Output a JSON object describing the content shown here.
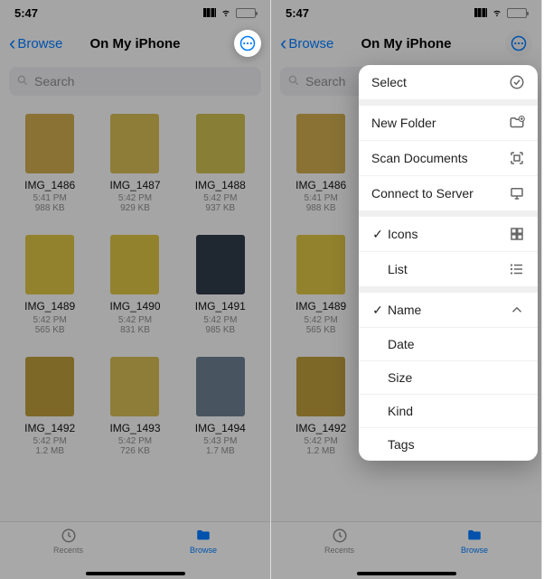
{
  "status": {
    "time": "5:47"
  },
  "nav": {
    "back": "Browse",
    "title": "On My iPhone"
  },
  "search": {
    "placeholder": "Search"
  },
  "tabs": {
    "recents": "Recents",
    "browse": "Browse"
  },
  "files": [
    {
      "name": "IMG_1486",
      "time": "5:41 PM",
      "size": "988 KB"
    },
    {
      "name": "IMG_1487",
      "time": "5:42 PM",
      "size": "929 KB"
    },
    {
      "name": "IMG_1488",
      "time": "5:42 PM",
      "size": "937 KB"
    },
    {
      "name": "IMG_1489",
      "time": "5:42 PM",
      "size": "565 KB"
    },
    {
      "name": "IMG_1490",
      "time": "5:42 PM",
      "size": "831 KB"
    },
    {
      "name": "IMG_1491",
      "time": "5:42 PM",
      "size": "985 KB"
    },
    {
      "name": "IMG_1492",
      "time": "5:42 PM",
      "size": "1.2 MB"
    },
    {
      "name": "IMG_1493",
      "time": "5:42 PM",
      "size": "726 KB"
    },
    {
      "name": "IMG_1494",
      "time": "5:43 PM",
      "size": "1.7 MB"
    }
  ],
  "menu": {
    "select": "Select",
    "new_folder": "New Folder",
    "scan": "Scan Documents",
    "connect": "Connect to Server",
    "icons": "Icons",
    "list": "List",
    "name": "Name",
    "date": "Date",
    "size": "Size",
    "kind": "Kind",
    "tags": "Tags"
  }
}
